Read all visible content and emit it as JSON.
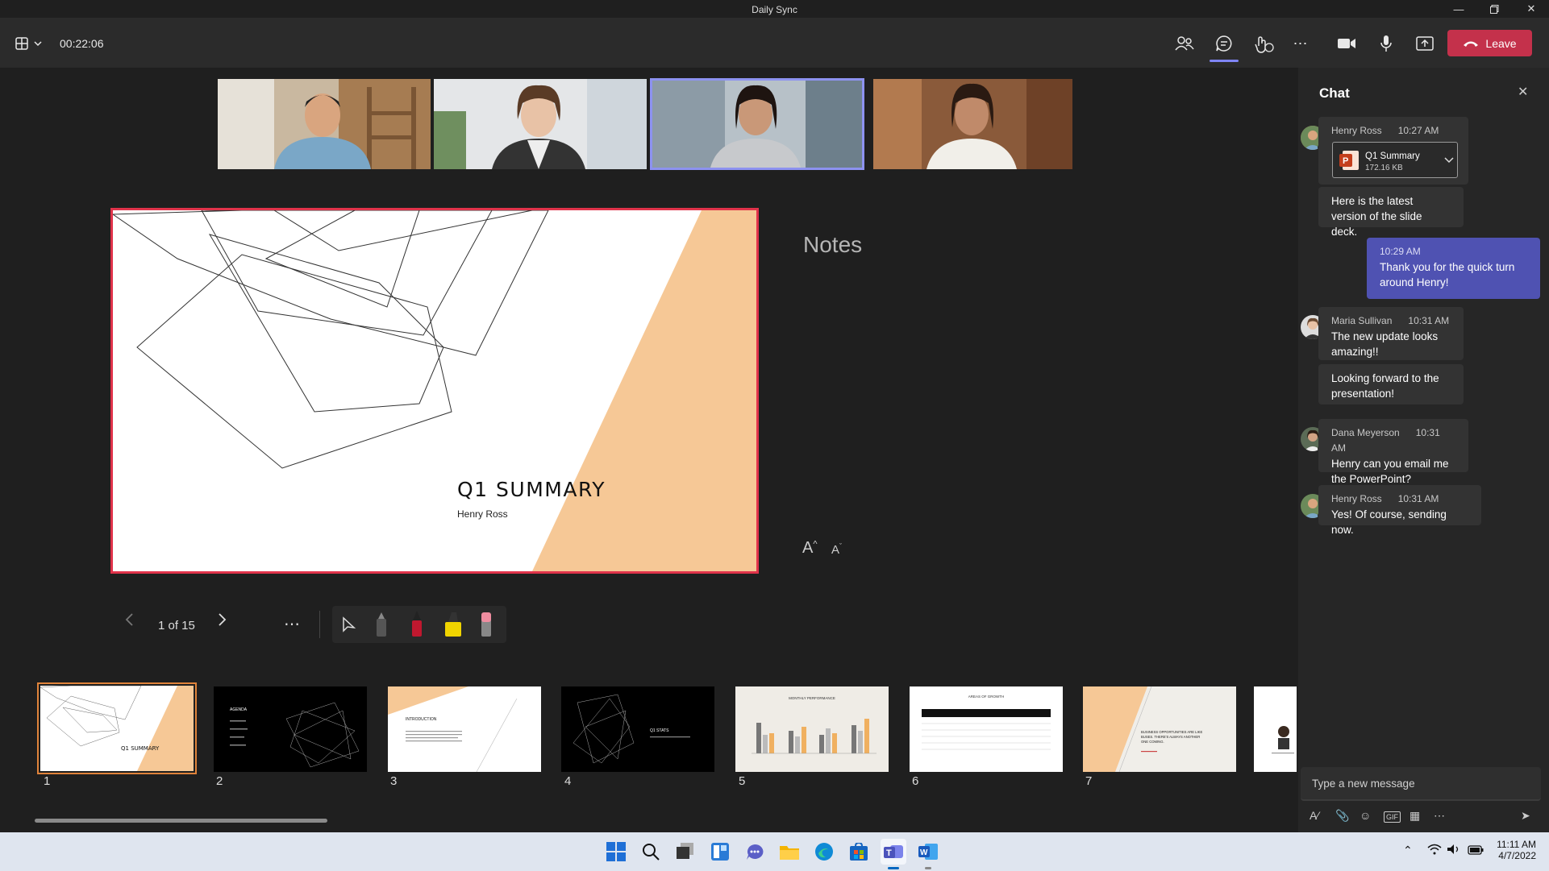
{
  "window": {
    "title": "Daily Sync"
  },
  "toolbar": {
    "timer": "00:22:06",
    "leave_label": "Leave",
    "accent": "#c4314b"
  },
  "participants": [
    {
      "name": "participant-1"
    },
    {
      "name": "participant-2"
    },
    {
      "name": "participant-3",
      "active": true
    },
    {
      "name": "participant-4"
    }
  ],
  "slide": {
    "title": "Q1 SUMMARY",
    "author": "Henry Ross"
  },
  "notes": {
    "heading": "Notes",
    "increase": "A",
    "decrease": "A"
  },
  "presenter": {
    "page": "1 of 15"
  },
  "thumbnails": [
    {
      "num": "1",
      "label": "Q1 SUMMARY"
    },
    {
      "num": "2",
      "label": "AGENDA"
    },
    {
      "num": "3",
      "label": "INTRODUCTION"
    },
    {
      "num": "4",
      "label": "Q1 STATS"
    },
    {
      "num": "5",
      "label": "MONTHLY PERFORMANCE"
    },
    {
      "num": "6",
      "label": "AREAS OF GROWTH"
    },
    {
      "num": "7",
      "label": "BUSINESS OPPORTUNITIES ARE LIKE BUSES. THERE'S ALWAYS ANOTHER ONE COMING."
    }
  ],
  "chat": {
    "title": "Chat",
    "input_placeholder": "Type a new message",
    "messages": [
      {
        "sender": "Henry Ross",
        "time": "10:27 AM",
        "file_name": "Q1 Summary",
        "file_size": "172.16 KB",
        "text": "Here is the latest version of the slide deck."
      },
      {
        "time": "10:29 AM",
        "text": "Thank you for the quick turn around Henry!"
      },
      {
        "sender": "Maria Sullivan",
        "time": "10:31 AM",
        "text": "The new update looks amazing!!",
        "text2": "Looking forward to the presentation!"
      },
      {
        "sender": "Dana Meyerson",
        "time": "10:31 AM",
        "text": "Henry can you email me the PowerPoint?"
      },
      {
        "sender": "Henry Ross",
        "time": "10:31 AM",
        "text": "Yes! Of course, sending now."
      }
    ]
  },
  "taskbar": {
    "time": "11:11 AM",
    "date": "4/7/2022"
  }
}
